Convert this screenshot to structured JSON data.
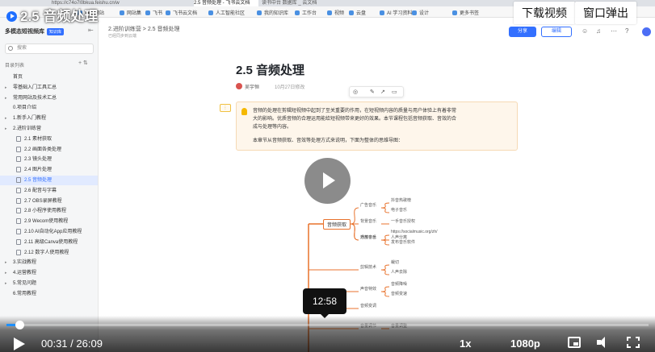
{
  "browser": {
    "url": "https://c74o7l0bkua.feishu.cn/w",
    "tabs": [
      "2.5 音频处理 - 飞书云文档",
      "读书中台 数据库 _ 云文档"
    ],
    "bookmarks": [
      "常用网站",
      "网站集",
      "飞书",
      "飞书云文档",
      "人工智能社区",
      "我的知识库",
      "工作台",
      "视频",
      "云盘",
      "AI 学习资料",
      "设计",
      "更多书签"
    ]
  },
  "video": {
    "title": "2.5 音频处理",
    "download_label": "下载视频",
    "popout_label": "窗口弹出",
    "current_time": "00:31",
    "duration": "26:09",
    "hover_time": "12:58",
    "progress_fraction": 0.0198,
    "speed": "1x",
    "quality": "1080p",
    "accent_color": "#1e90ff"
  },
  "sidebar": {
    "space_name": "多模态短视频库",
    "badge": "知识库",
    "search_placeholder": "搜索",
    "section_label": "目录列表",
    "items": [
      {
        "label": "首页",
        "level": 1,
        "caret": false
      },
      {
        "label": "零基础入门工具汇总",
        "level": 1,
        "caret": true
      },
      {
        "label": "常用网站及技术汇总",
        "level": 1,
        "caret": true
      },
      {
        "label": "0.项目介绍",
        "level": 1,
        "caret": false
      },
      {
        "label": "1.新手入门教程",
        "level": 1,
        "caret": true
      },
      {
        "label": "2.进阶训练营",
        "level": 1,
        "caret": true
      },
      {
        "label": "2.1 素材获取",
        "level": 2,
        "caret": false
      },
      {
        "label": "2.2 画面各类处理",
        "level": 2,
        "caret": false
      },
      {
        "label": "2.3 镜头处理",
        "level": 2,
        "caret": false
      },
      {
        "label": "2.4 图片处理",
        "level": 2,
        "caret": false
      },
      {
        "label": "2.5 音频处理",
        "level": 2,
        "caret": false,
        "active": true
      },
      {
        "label": "2.6 配音与字幕",
        "level": 2,
        "caret": false
      },
      {
        "label": "2.7 OBS录屏教程",
        "level": 2,
        "caret": false
      },
      {
        "label": "2.8 小程序使用教程",
        "level": 2,
        "caret": false
      },
      {
        "label": "2.9 Wecom使用教程",
        "level": 2,
        "caret": false
      },
      {
        "label": "2.10 AI自动化App应用教程",
        "level": 2,
        "caret": false
      },
      {
        "label": "2.11 高级Canva使用教程",
        "level": 2,
        "caret": false
      },
      {
        "label": "2.12 数字人使用教程",
        "level": 2,
        "caret": false
      },
      {
        "label": "3.实战教程",
        "level": 1,
        "caret": true
      },
      {
        "label": "4.运营教程",
        "level": 1,
        "caret": true
      },
      {
        "label": "5.常见问题",
        "level": 1,
        "caret": true
      },
      {
        "label": "6.常用教程",
        "level": 1,
        "caret": false
      }
    ]
  },
  "doc": {
    "breadcrumb": "2.进阶训练营 > 2.5 音频处理",
    "subtitle": "已经同步到云端",
    "share_label": "分享",
    "edit_label": "编辑",
    "title": "2.5 音频处理",
    "author": "吴宇恒",
    "date": "10月27日修改",
    "callout_lines": [
      "音频的处理在剪辑短视频中起到了至关重要的作用，在短视频内容的质量与用户体验上有着非常",
      "大的影响。优质音频的合理运用能给短视频带来更好的效果。本节课程包括音频获取、音效的合",
      "成与处理等内容。",
      "本章节从音频获取、音效等处理方式来说明，下面为整体的思维导图："
    ]
  },
  "mindmap": {
    "root": "音频获取",
    "branches": [
      {
        "label": "广告音乐",
        "children": [
          "抖音热歌榜",
          "电子音乐"
        ]
      },
      {
        "label": "背景音乐",
        "children": [
          "一手音乐授权"
        ]
      },
      {
        "label": "通用音乐",
        "children": [
          "人声分离"
        ]
      },
      {
        "label": "开放平台",
        "children": [
          "https://socialmusic.org/zh/",
          "发布音乐软件"
        ]
      },
      {
        "label": "剪辑技术",
        "children": [
          "裁切",
          "人声去除"
        ]
      },
      {
        "label": "声音特效",
        "children": [
          "音频降噪",
          "音频变速"
        ]
      },
      {
        "label": "音频变调",
        "children": []
      },
      {
        "label": "音量调节",
        "children": [
          "音量调整"
        ]
      }
    ],
    "line_color": "#e8722c"
  }
}
